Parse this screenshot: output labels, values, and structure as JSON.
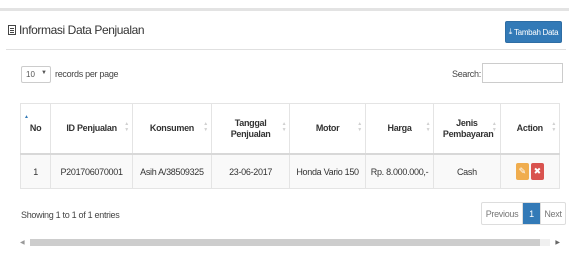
{
  "header": {
    "title": "Informasi Data Penjualan",
    "add_button": "Tambah Data"
  },
  "controls": {
    "page_length": "10",
    "length_label": "records per page",
    "search_label": "Search:",
    "search_value": ""
  },
  "table": {
    "columns": [
      "No",
      "ID Penjualan",
      "Konsumen",
      "Tanggal Penjualan",
      "Motor",
      "Harga",
      "Jenis Pembayaran",
      "Action"
    ],
    "rows": [
      [
        "1",
        "P201706070001",
        "Asih A/38509325",
        "23-06-2017",
        "Honda Vario 150",
        "Rp. 8.000.000,-",
        "Cash"
      ]
    ]
  },
  "footer": {
    "info": "Showing 1 to 1 of 1 entries",
    "prev": "Previous",
    "current_page": "1",
    "next": "Next"
  },
  "colors": {
    "primary": "#337ab7",
    "warning": "#f0ad4e",
    "danger": "#d9534f"
  }
}
